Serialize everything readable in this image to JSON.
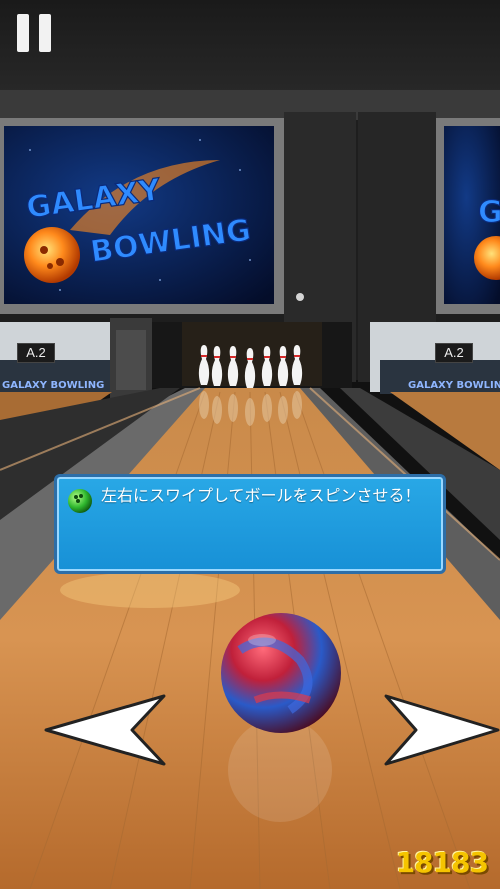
{
  "hud": {
    "pause_icon": "pause-icon"
  },
  "screens": {
    "logo_line1": "GALAXY",
    "logo_line2": "BOWLING",
    "logo_small": "GALAXY BOWLING"
  },
  "lanes": {
    "left_label": "A.2",
    "right_label": "A.2"
  },
  "hint": {
    "icon": "green-ball-icon",
    "text": "左右にスワイプしてボールをスピンさせる！"
  },
  "controls": {
    "left_arrow": "arrow-left-icon",
    "right_arrow": "arrow-right-icon"
  },
  "watermark": {
    "text": "18183"
  },
  "colors": {
    "panel": "#1f9de0",
    "ball_red": "#c0203a",
    "ball_blue": "#2a5ac8",
    "arrow": "#ffffff"
  }
}
